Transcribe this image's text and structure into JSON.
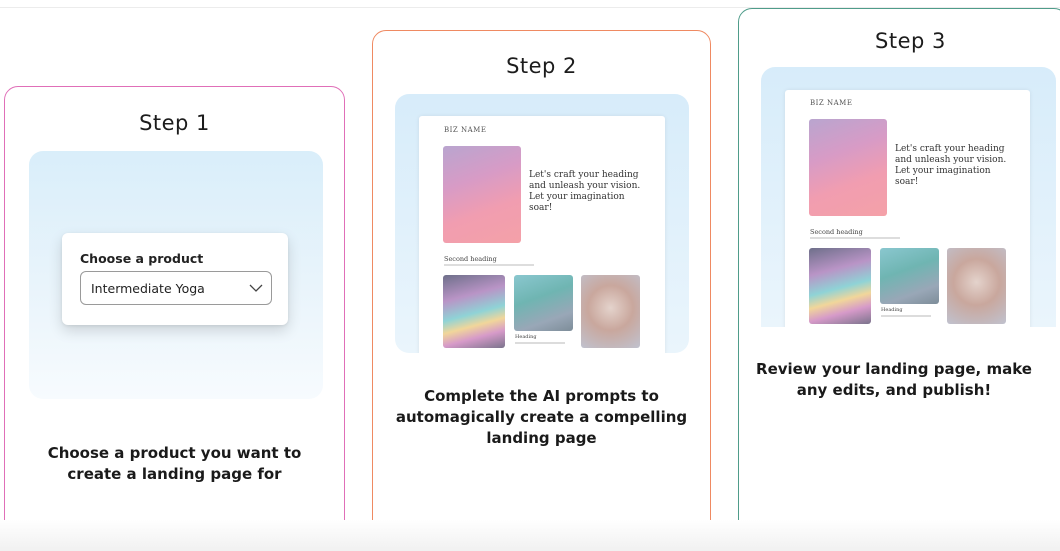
{
  "steps": [
    {
      "title": "Step 1",
      "description": "Choose a product you want to create a landing page for",
      "popup": {
        "label": "Choose a product",
        "selected": "Intermediate Yoga"
      }
    },
    {
      "title": "Step 2",
      "description": "Complete the AI prompts to automagically create a compelling landing page",
      "mock": {
        "biz_name": "BIZ NAME",
        "hero_text": "Let's craft your heading and unleash your vision. Let your imagination soar!",
        "second_heading": "Second heading",
        "thumb_heading": "Heading"
      }
    },
    {
      "title": "Step 3",
      "description": "Review your landing page, make any edits, and publish!",
      "mock": {
        "biz_name": "BIZ NAME",
        "hero_text": "Let's craft your heading and unleash your vision. Let your imagination soar!",
        "second_heading": "Second heading",
        "thumb_heading": "Heading"
      }
    }
  ],
  "colors": {
    "step1_border": "#e06fb8",
    "step2_border": "#ef8a62",
    "step3_border": "#4f9c8a"
  }
}
